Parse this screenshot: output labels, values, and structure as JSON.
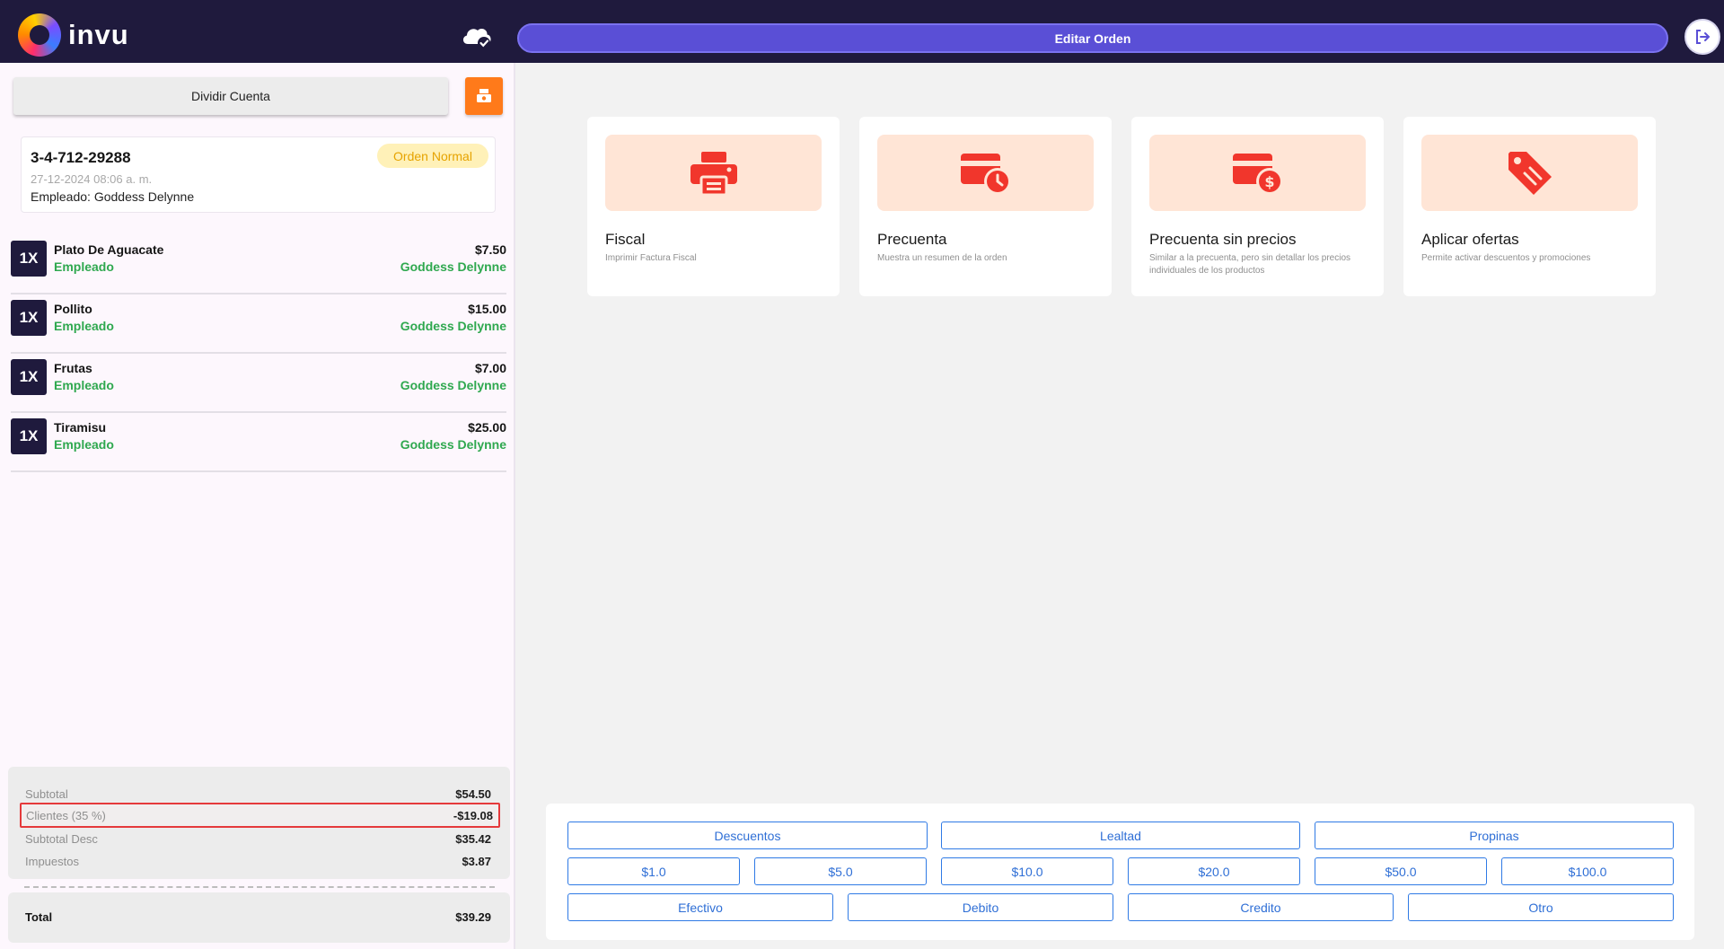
{
  "header": {
    "brand": "invu",
    "edit_order_label": "Editar Orden",
    "icons": {
      "logo": "invu-logo-icon",
      "cloud": "cloud-check-icon",
      "logout": "logout-icon"
    }
  },
  "sidebar": {
    "split_label": "Dividir Cuenta",
    "drawer_icon": "cash-drawer-icon",
    "order": {
      "id": "3-4-712-29288",
      "datetime": "27-12-2024 08:06 a. m.",
      "employee_label": "Empleado:",
      "employee_name": "Goddess Delynne",
      "badge": "Orden Normal"
    },
    "items": [
      {
        "qty": "1X",
        "name": "Plato De Aguacate",
        "role": "Empleado",
        "price": "$7.50",
        "employee": "Goddess Delynne"
      },
      {
        "qty": "1X",
        "name": "Pollito",
        "role": "Empleado",
        "price": "$15.00",
        "employee": "Goddess Delynne"
      },
      {
        "qty": "1X",
        "name": "Frutas",
        "role": "Empleado",
        "price": "$7.00",
        "employee": "Goddess Delynne"
      },
      {
        "qty": "1X",
        "name": "Tiramisu",
        "role": "Empleado",
        "price": "$25.00",
        "employee": "Goddess Delynne"
      }
    ],
    "totals": {
      "subtotal_label": "Subtotal",
      "subtotal": "$54.50",
      "clients_label": "Clientes (35 %)",
      "clients": "-$19.08",
      "subtotal_desc_label": "Subtotal Desc",
      "subtotal_desc": "$35.42",
      "taxes_label": "Impuestos",
      "taxes": "$3.87",
      "total_label": "Total",
      "total": "$39.29"
    }
  },
  "actions": [
    {
      "title": "Fiscal",
      "desc": "Imprimir Factura Fiscal",
      "icon": "printer-icon"
    },
    {
      "title": "Precuenta",
      "desc": "Muestra un resumen de la orden",
      "icon": "card-clock-icon"
    },
    {
      "title": "Precuenta sin precios",
      "desc": "Similar a la precuenta, pero sin detallar los precios individuales de los productos",
      "icon": "card-dollar-icon"
    },
    {
      "title": "Aplicar ofertas",
      "desc": "Permite activar descuentos y promociones",
      "icon": "tag-icon"
    }
  ],
  "payment": {
    "row1": [
      "Descuentos",
      "Lealtad",
      "Propinas"
    ],
    "row2": [
      "$1.0",
      "$5.0",
      "$10.0",
      "$20.0",
      "$50.0",
      "$100.0"
    ],
    "row3": [
      "Efectivo",
      "Debito",
      "Credito",
      "Otro"
    ]
  },
  "colors": {
    "header_bg": "#1f1a3d",
    "accent_purple": "#5a4fd6",
    "accent_orange": "#ff7a1a",
    "icon_red": "#f1362c",
    "success_green": "#2fa84f",
    "link_blue": "#2f7ae5",
    "highlight_red": "#e5393b"
  }
}
